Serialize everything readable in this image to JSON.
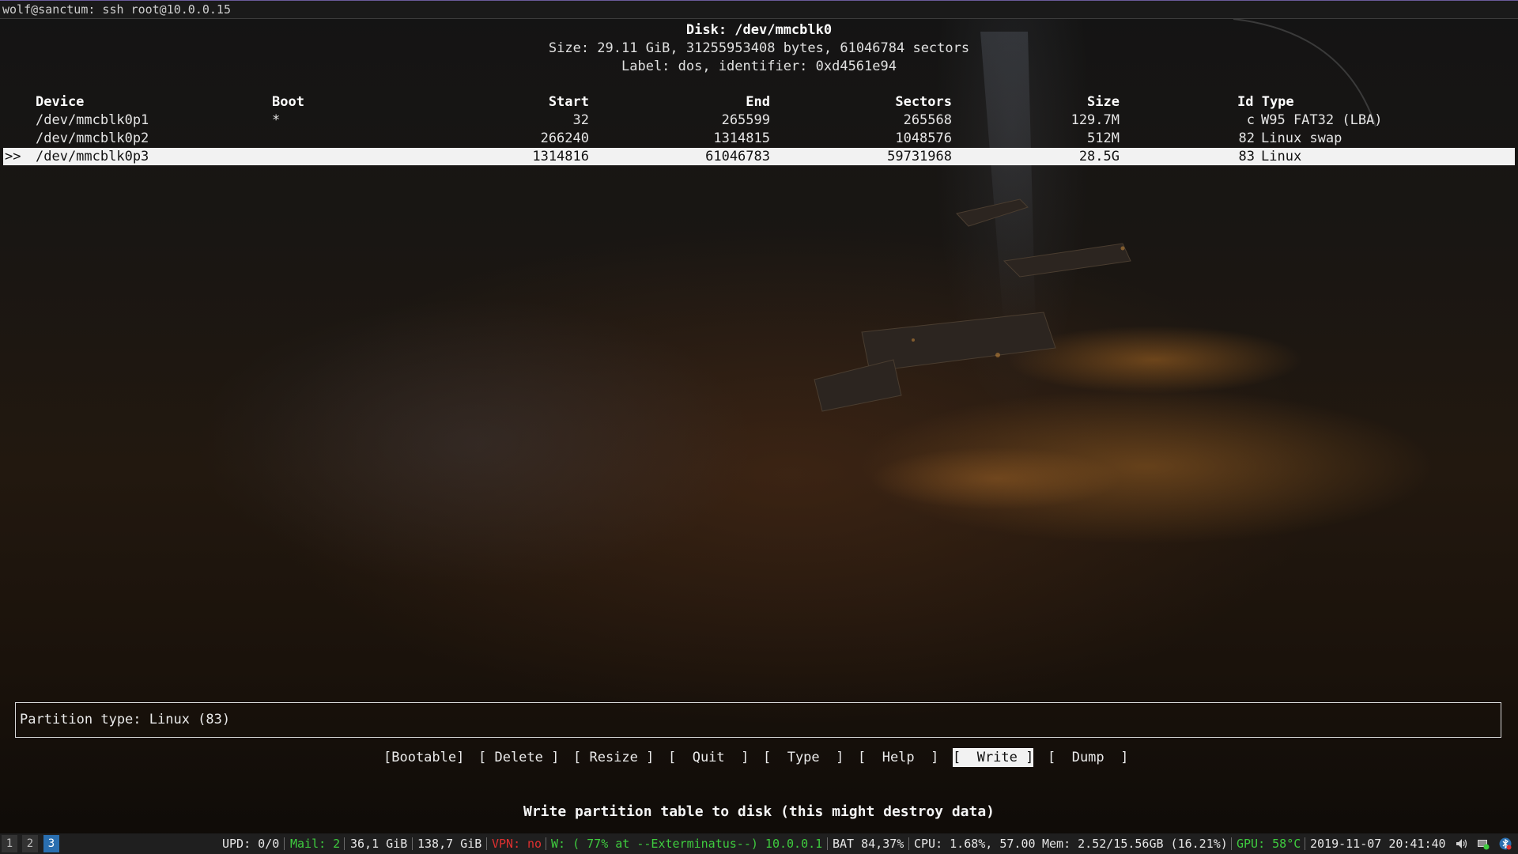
{
  "window": {
    "title": "wolf@sanctum: ssh root@10.0.0.15"
  },
  "disk": {
    "title": "Disk: /dev/mmcblk0",
    "size_line": "Size: 29.11 GiB, 31255953408 bytes, 61046784 sectors",
    "label_line": "Label: dos, identifier: 0xd4561e94"
  },
  "table": {
    "headers": {
      "device": "Device",
      "boot": "Boot",
      "start": "Start",
      "end": "End",
      "sectors": "Sectors",
      "size": "Size",
      "id_type": "Id Type"
    },
    "rows": [
      {
        "marker": "",
        "device": "/dev/mmcblk0p1",
        "boot": "*",
        "start": "32",
        "end": "265599",
        "sectors": "265568",
        "size": "129.7M",
        "id": "c",
        "type": "W95 FAT32 (LBA)"
      },
      {
        "marker": "",
        "device": "/dev/mmcblk0p2",
        "boot": "",
        "start": "266240",
        "end": "1314815",
        "sectors": "1048576",
        "size": "512M",
        "id": "82",
        "type": "Linux swap"
      },
      {
        "marker": ">>",
        "device": "/dev/mmcblk0p3",
        "boot": "",
        "start": "1314816",
        "end": "61046783",
        "sectors": "59731968",
        "size": "28.5G",
        "id": "83",
        "type": "Linux"
      }
    ]
  },
  "info": {
    "text": "Partition type: Linux (83)"
  },
  "menu": {
    "bootable": "[Bootable]",
    "delete": "[ Delete ]",
    "resize": "[ Resize ]",
    "quit": "[  Quit  ]",
    "type": "[  Type  ]",
    "help": "[  Help  ]",
    "write": "[  Write ]",
    "dump": "[  Dump  ]",
    "selected": "write"
  },
  "status_message": "Write partition table to disk (this might destroy data)",
  "statusbar": {
    "workspaces": [
      "1",
      "2",
      "3"
    ],
    "active_workspace": "3",
    "upd": "UPD: 0/0",
    "mail": "Mail: 2",
    "disk1": "36,1 GiB",
    "disk2": "138,7 GiB",
    "vpn_label": "VPN:",
    "vpn_value": "no",
    "wifi": "W: ( 77% at --Exterminatus--) 10.0.0.1",
    "battery": "BAT 84,37%",
    "cpu": "CPU: 1.68%, 57.00",
    "mem": "Mem: 2.52/15.56GB (16.21%)",
    "gpu": "GPU: 58°C",
    "datetime": "2019-11-07 20:41:40",
    "tray_icons": [
      "volume-icon",
      "network-icon",
      "bluetooth-icon"
    ],
    "colors": {
      "good": "#3fcc3f",
      "bad": "#e03030",
      "accent": "#2a6fb0"
    }
  }
}
